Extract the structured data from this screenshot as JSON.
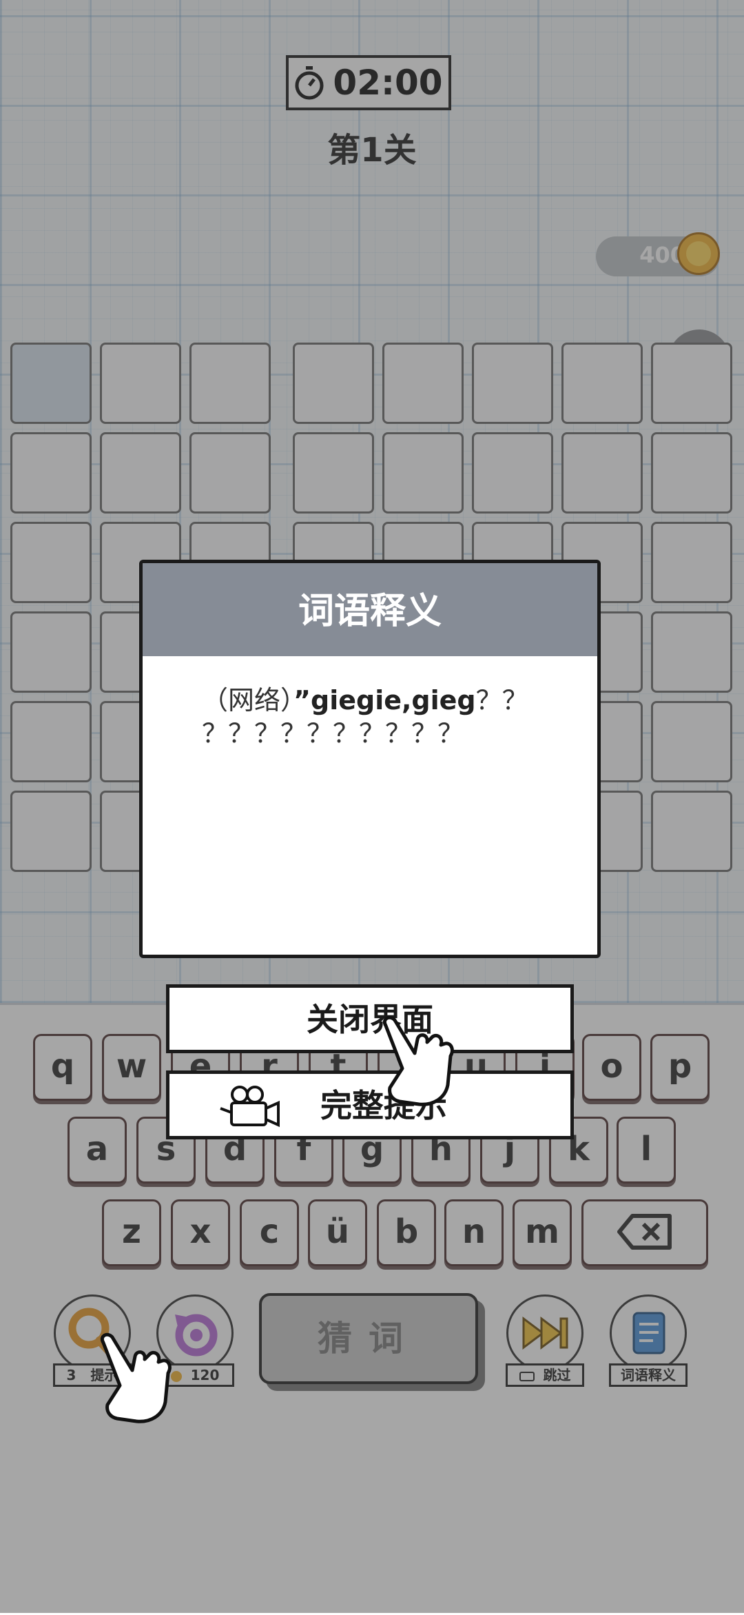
{
  "timer": {
    "value": "02:00",
    "icon": "stopwatch-icon"
  },
  "level": {
    "title": "第1关"
  },
  "coins": {
    "value": "400",
    "icon": "star-coin-icon"
  },
  "help": {
    "label": "?"
  },
  "keyboard": {
    "row1": [
      "q",
      "w",
      "e",
      "r",
      "t",
      "y",
      "u",
      "i",
      "o",
      "p"
    ],
    "row2": [
      "a",
      "s",
      "d",
      "f",
      "g",
      "h",
      "j",
      "k",
      "l"
    ],
    "row3": [
      "z",
      "x",
      "c",
      "ü",
      "b",
      "n",
      "m"
    ],
    "backspace_icon": "backspace-icon"
  },
  "tools": {
    "hint_count": "3",
    "hint_label": "提示",
    "hint_icon": "magnifier-icon",
    "refresh_cost": "120",
    "refresh_icon": "refresh-icon",
    "guess_label": "猜词",
    "skip_label": "跳过",
    "skip_icon": "fast-forward-icon",
    "define_label": "词语释义",
    "define_icon": "document-icon"
  },
  "dialog": {
    "title": "词语释义",
    "body_prefix": "（网络）",
    "body_bold": "”giegie,gieg",
    "body_rest_1": "？？",
    "body_rest_2": "？？？？？？？？？？"
  },
  "buttons": {
    "close": "关闭界面",
    "full_hint": "完整提示"
  },
  "colors": {
    "dialog_header": "#868c96",
    "coin": "#f2b233",
    "hint_tool": "#e89a2a",
    "refresh_tool": "#b66bd6",
    "skip_tool": "#f2c23a",
    "define_tool": "#4a90d9"
  }
}
